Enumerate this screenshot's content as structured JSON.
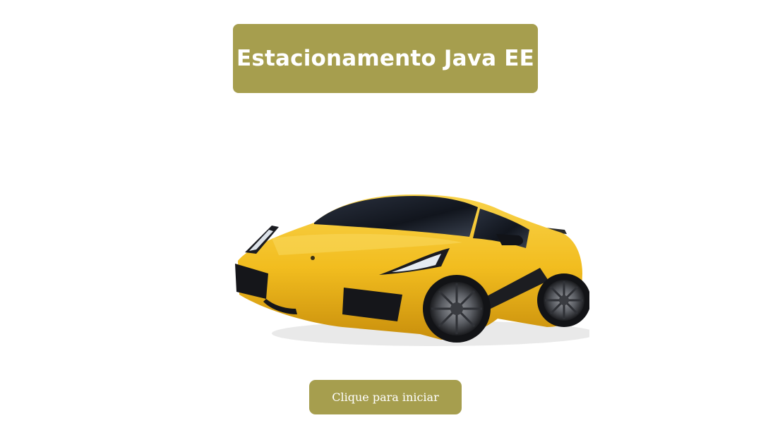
{
  "header": {
    "title": "Estacionamento Java EE"
  },
  "hero": {
    "image": "yellow-sports-car"
  },
  "actions": {
    "start_label": "Clique para iniciar"
  },
  "colors": {
    "accent": "#a69e4e",
    "car_body": "#f2bd1f",
    "background": "#ffffff"
  }
}
